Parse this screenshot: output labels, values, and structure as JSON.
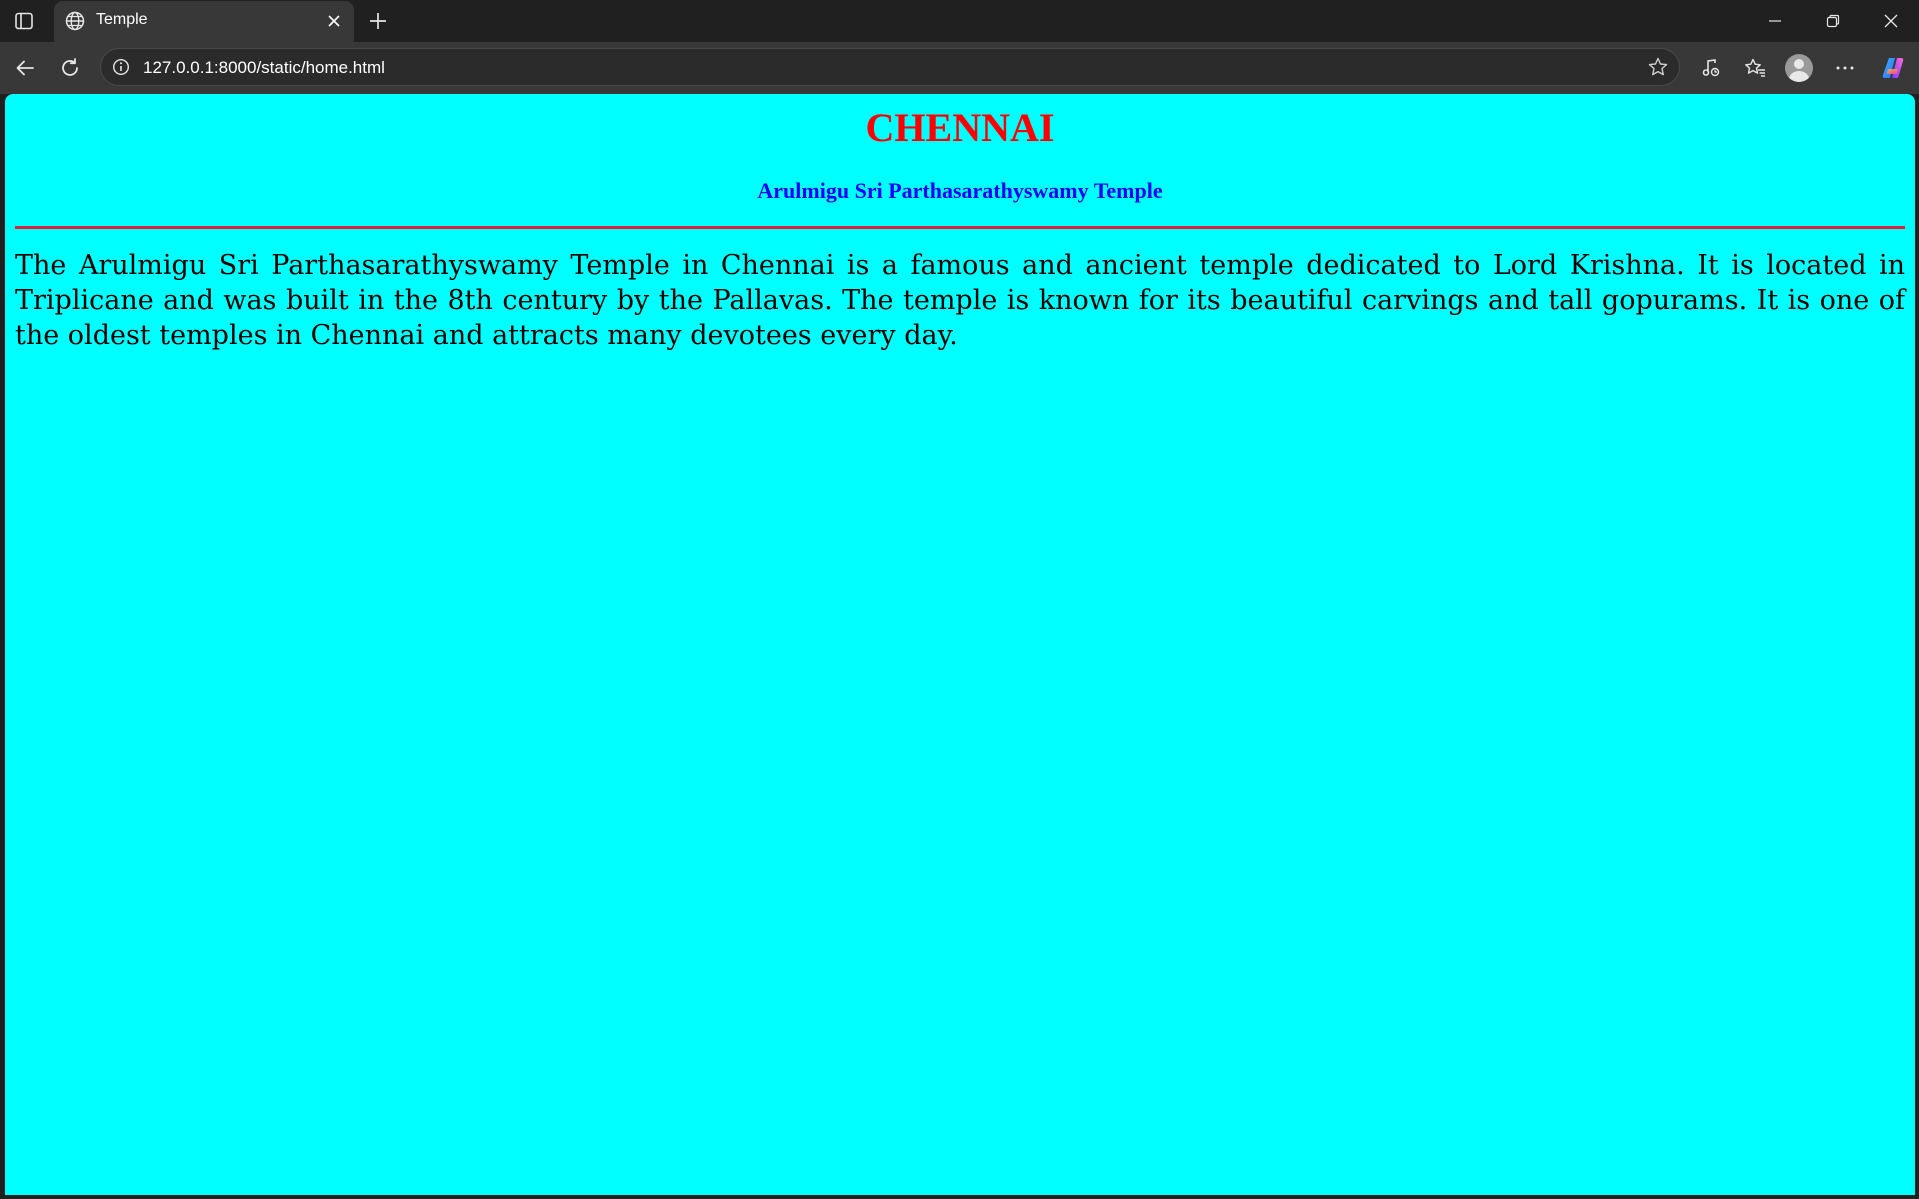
{
  "browser": {
    "tab": {
      "title": "Temple"
    },
    "address_bar": {
      "url": "127.0.0.1:8000/static/home.html"
    },
    "icons": {
      "tab_actions": "tab-actions-icon",
      "favicon": "globe-icon",
      "tab_close": "close-icon",
      "new_tab": "plus-icon",
      "minimize": "minimize-icon",
      "maximize": "restore-icon",
      "close": "close-icon",
      "back": "back-arrow-icon",
      "reload": "reload-icon",
      "site_info": "info-icon",
      "favorite": "star-icon",
      "media": "media-control-icon",
      "favorites": "favorites-icon",
      "profile": "profile-avatar",
      "more": "more-dots-icon",
      "copilot": "copilot-icon"
    }
  },
  "page": {
    "background": "#00ffff",
    "heading": "CHENNAI",
    "heading_color": "#ff0000",
    "subheading": "Arulmigu Sri Parthasarathyswamy Temple",
    "subheading_color": "#0000ff",
    "rule_color": "#dd1f3a",
    "paragraph": "The Arulmigu Sri Parthasarathyswamy Temple in Chennai is a famous and ancient temple dedicated to Lord Krishna. It is located in Triplicane and was built in the 8th century by the Pallavas. The temple is known for its beautiful carvings and tall gopurams. It is one of the oldest temples in Chennai and attracts many devotees every day."
  }
}
